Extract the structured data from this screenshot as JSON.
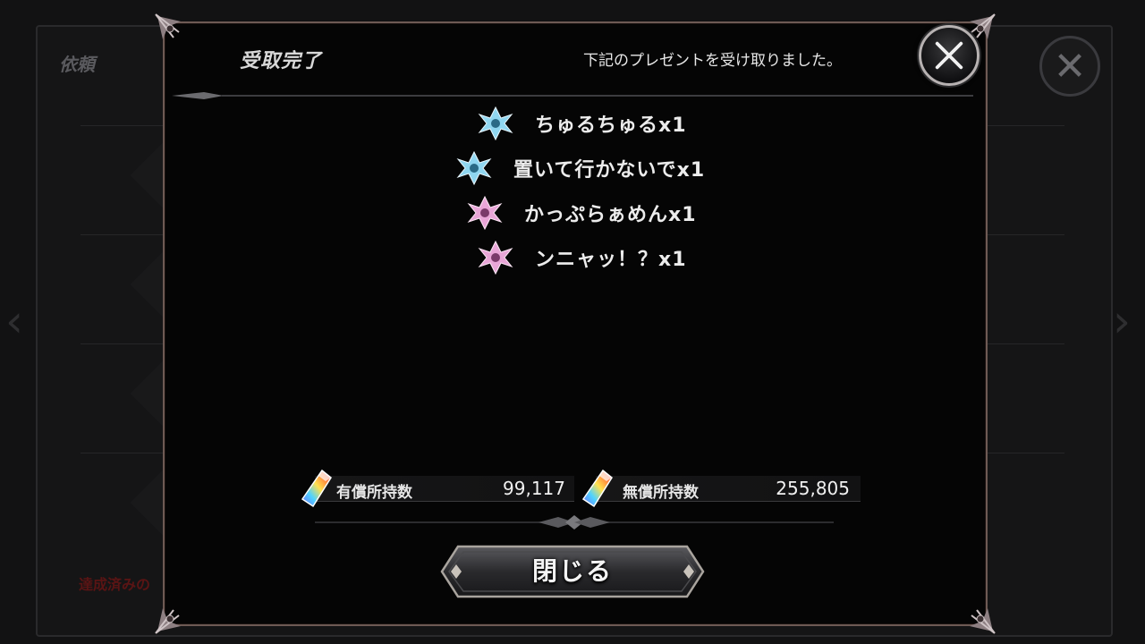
{
  "background": {
    "title": "依頼",
    "footer": "達成済みの",
    "rows": [
      "",
      "",
      "",
      ""
    ]
  },
  "dialog": {
    "title": "受取完了",
    "message": "下記のプレゼントを受け取りました。",
    "items": [
      {
        "label": "ちゅるちゅるx1",
        "gem_color": "#8fd6f0"
      },
      {
        "label": "置いて行かないでx1",
        "gem_color": "#8fd6f0"
      },
      {
        "label": "かっぷらぁめんx1",
        "gem_color": "#e9a6d8"
      },
      {
        "label": "ンニャッ！？x1",
        "gem_color": "#e9a6d8"
      }
    ],
    "paid": {
      "label": "有償所持数",
      "value": "99,117"
    },
    "free": {
      "label": "無償所持数",
      "value": "255,805"
    },
    "close_button": "閉じる"
  },
  "colors": {
    "frame": "#6e5a54",
    "ornament": "#8d7f82",
    "footer_red": "#5a1414"
  },
  "icons": {
    "close": "close-x-icon",
    "item_gem": "crest-gem-icon",
    "currency": "rainbow-crystal-icon"
  }
}
